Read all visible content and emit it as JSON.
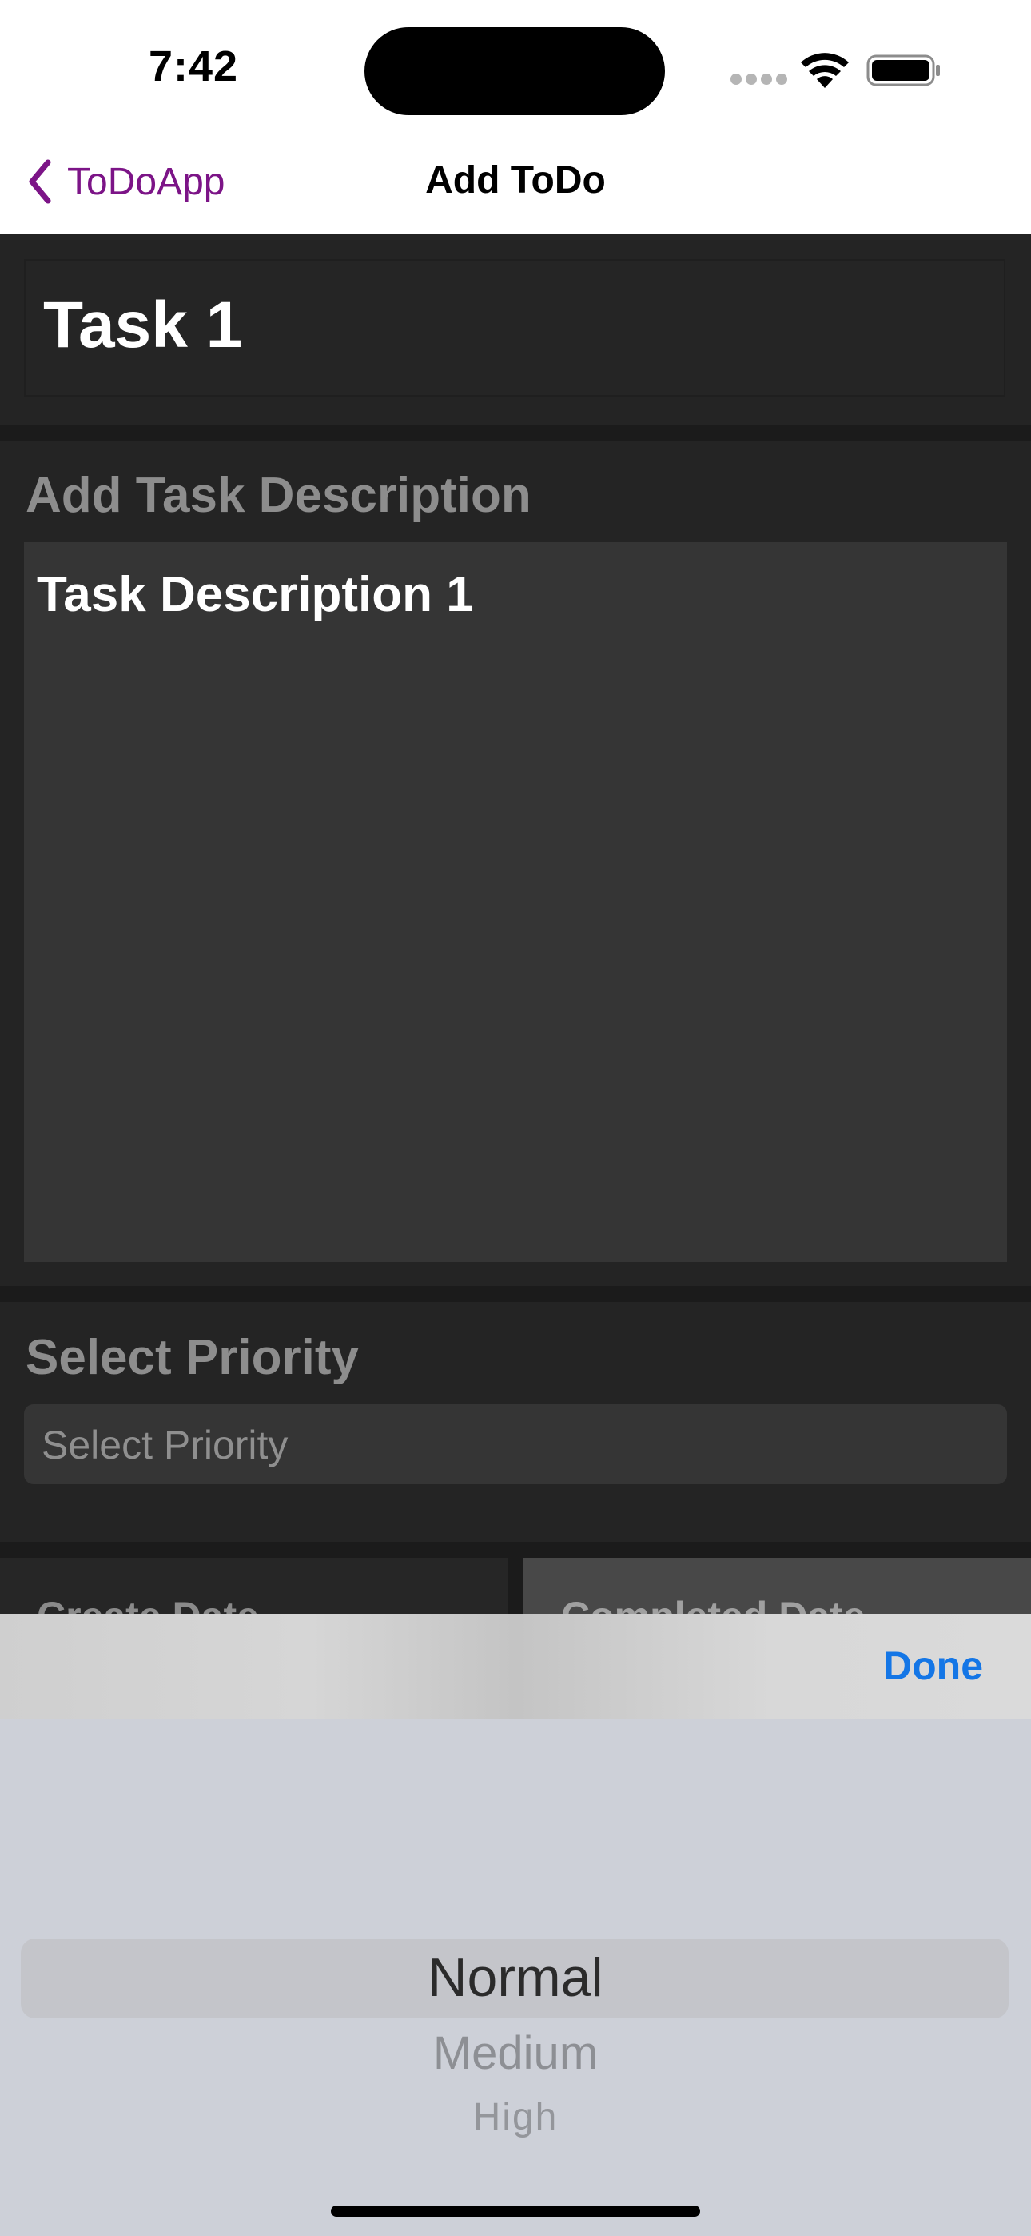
{
  "status_bar": {
    "time": "7:42"
  },
  "nav": {
    "back_label": "ToDoApp",
    "title": "Add ToDo"
  },
  "task": {
    "title_value": "Task 1"
  },
  "description": {
    "label": "Add Task Description",
    "value": "Task Description 1"
  },
  "priority": {
    "label": "Select Priority",
    "placeholder": "Select Priority"
  },
  "dates": {
    "create_label": "Create Date",
    "completed_label": "Completed Date"
  },
  "picker": {
    "done_label": "Done",
    "options": [
      "Normal",
      "Medium",
      "High"
    ]
  },
  "colors": {
    "accent_back": "#7c1487",
    "done_blue": "#1476e6"
  }
}
